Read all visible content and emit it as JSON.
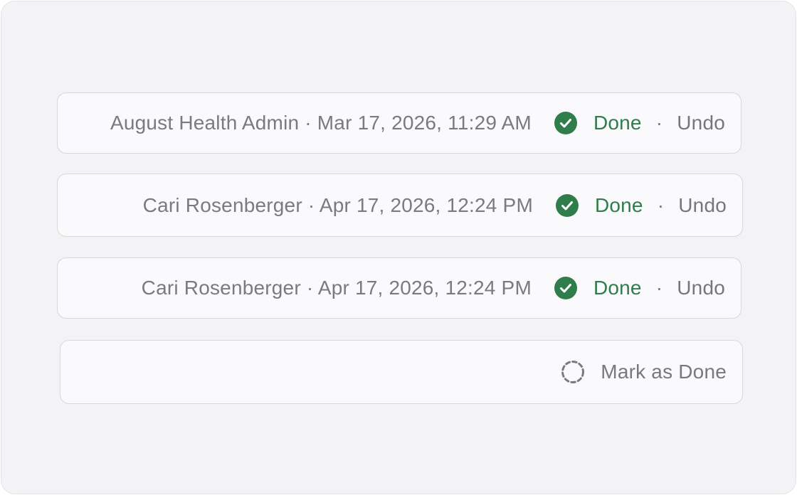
{
  "items": [
    {
      "author": "August Health Admin",
      "timestamp": "Mar 17, 2026, 11:29 AM",
      "separator": "·",
      "status_label": "Done",
      "action_separator": "·",
      "undo_label": "Undo"
    },
    {
      "author": "Cari Rosenberger",
      "timestamp": "Apr 17, 2026, 12:24 PM",
      "separator": "·",
      "status_label": "Done",
      "action_separator": "·",
      "undo_label": "Undo"
    },
    {
      "author": "Cari Rosenberger",
      "timestamp": "Apr 17, 2026, 12:24 PM",
      "separator": "·",
      "status_label": "Done",
      "action_separator": "·",
      "undo_label": "Undo"
    }
  ],
  "pending": {
    "label": "Mark as Done"
  },
  "colors": {
    "done_green": "#2f7d4b",
    "muted_text": "#7a7a80",
    "row_background": "#faf9fb",
    "row_border": "#d9d8d6",
    "panel_background": "#f3f3f6"
  },
  "icons": {
    "done": "check-circle-icon",
    "pending": "dashed-circle-icon"
  }
}
